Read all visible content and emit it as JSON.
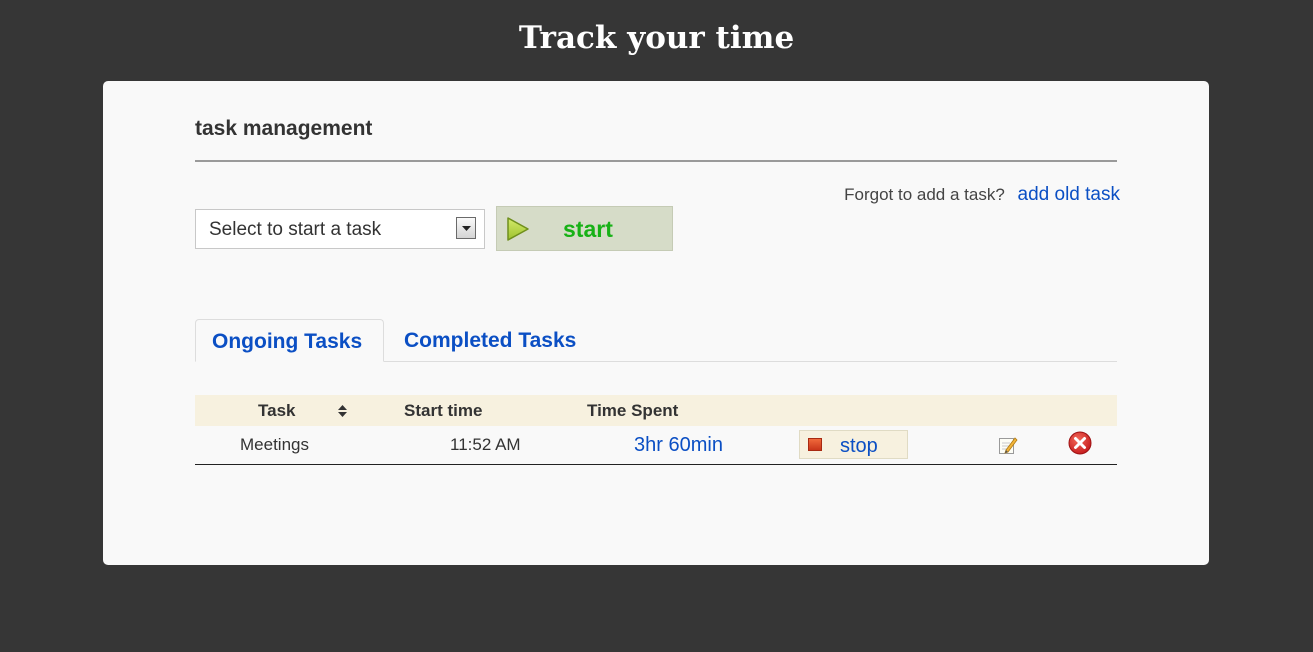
{
  "page": {
    "title": "Track your time"
  },
  "panel": {
    "heading": "task management",
    "forgot_text": "Forgot to add a task?",
    "add_old_task_link": "add old task"
  },
  "task_select": {
    "selected": "Select to start a task"
  },
  "start_button": {
    "label": "start"
  },
  "tabs": [
    {
      "label": "Ongoing Tasks",
      "active": true
    },
    {
      "label": "Completed Tasks",
      "active": false
    }
  ],
  "table": {
    "headers": {
      "task": "Task",
      "start_time": "Start time",
      "time_spent": "Time Spent"
    },
    "rows": [
      {
        "task": "Meetings",
        "start_time": "11:52 AM",
        "time_spent": "3hr 60min",
        "stop_label": "stop"
      }
    ]
  },
  "colors": {
    "background": "#363636",
    "card": "#f9f9f9",
    "link": "#0b4fc4",
    "start_text": "#17b116",
    "start_bg": "#d6dcc8",
    "header_bg": "#f7f1df"
  },
  "icons": {
    "select_arrow": "caret-down-icon",
    "start": "play-icon",
    "sort": "sort-icon",
    "stop": "stop-square-icon",
    "edit": "edit-icon",
    "delete": "delete-icon"
  }
}
